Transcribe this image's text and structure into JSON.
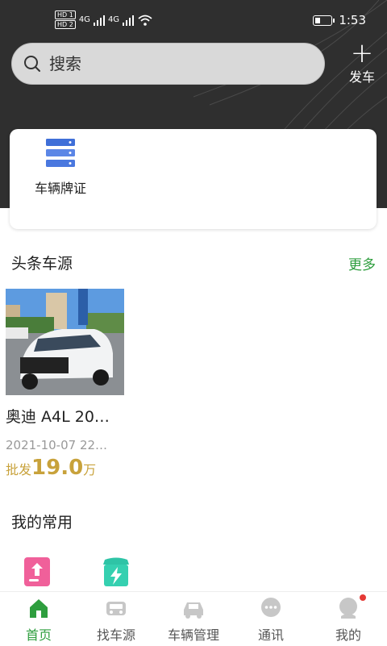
{
  "status_bar": {
    "network": "4G",
    "sim1": "HD 1",
    "sim2": "HD 2",
    "time": "1:53"
  },
  "search": {
    "placeholder": "搜索"
  },
  "post_button": {
    "label": "发车"
  },
  "tools": [
    {
      "label": "车辆牌证",
      "icon": "database-icon"
    }
  ],
  "sections": {
    "headline": "头条车源",
    "more": "更多",
    "favorites": "我的常用"
  },
  "listings": [
    {
      "title": "奥迪 A4L 20…",
      "date": "2021-10-07 22…",
      "price_prefix": "批发",
      "price": "19.0",
      "price_unit": "万"
    }
  ],
  "favorites": [
    {
      "icon": "publish-icon"
    },
    {
      "icon": "flash-sale-icon"
    }
  ],
  "tabs": [
    {
      "label": "首页",
      "icon": "home-icon",
      "active": true
    },
    {
      "label": "找车源",
      "icon": "car-search-icon"
    },
    {
      "label": "车辆管理",
      "icon": "car-icon"
    },
    {
      "label": "通讯",
      "icon": "chat-icon"
    },
    {
      "label": "我的",
      "icon": "user-icon",
      "badge": true
    }
  ],
  "colors": {
    "accent": "#2e9e3e",
    "price": "#c8a23b",
    "header_bg": "#2f2f2f",
    "badge": "#e53935"
  }
}
